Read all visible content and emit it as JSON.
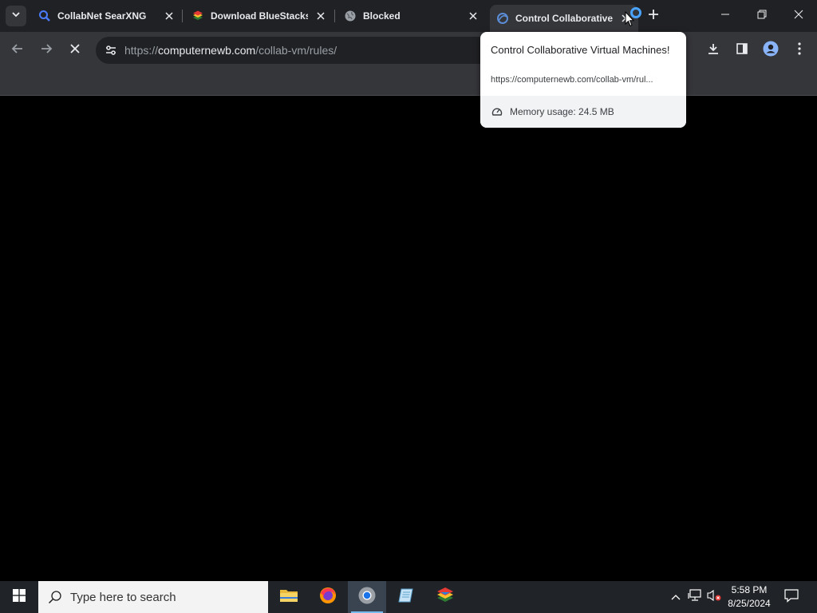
{
  "browser": {
    "tabs": [
      {
        "title": "CollabNet SearXNG",
        "icon": "magnifier-favicon"
      },
      {
        "title": "Download BlueStacks",
        "icon": "bluestacks-favicon"
      },
      {
        "title": "Blocked",
        "icon": "globe-favicon"
      },
      {
        "title": "Control Collaborative",
        "icon": "collabvm-favicon",
        "active": true
      }
    ],
    "address": {
      "scheme": "https://",
      "host": "computernewb.com",
      "path": "/collab-vm/rules/"
    }
  },
  "hover_card": {
    "title": "Control Collaborative Virtual Machines!",
    "url": "https://computernewb.com/collab-vm/rul...",
    "memory": "Memory usage: 24.5 MB"
  },
  "taskbar": {
    "search_placeholder": "Type here to search",
    "apps": [
      "file-explorer",
      "firefox",
      "chrome",
      "notepad",
      "bluestacks"
    ],
    "time": "5:58 PM",
    "date": "8/25/2024"
  },
  "colors": {
    "tabstrip": "#202124",
    "toolbar": "#35363a",
    "taskbar": "#202428",
    "accent": "#76b9ed"
  }
}
